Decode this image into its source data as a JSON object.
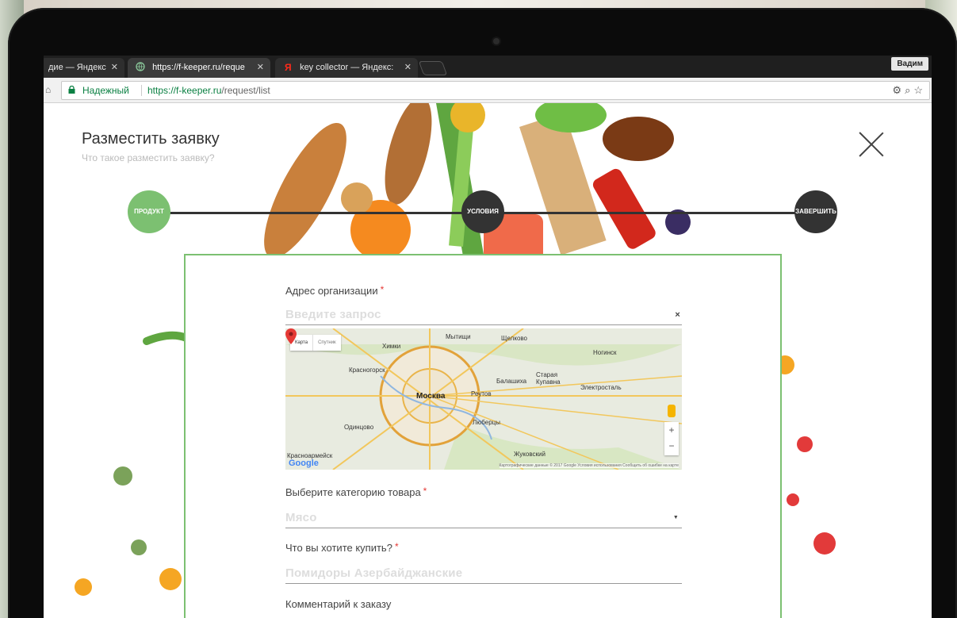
{
  "browser": {
    "tabs": [
      {
        "label": "дие — Яндекс",
        "close": "✕"
      },
      {
        "label": "https://f-keeper.ru/reque",
        "close": "✕"
      },
      {
        "label": "key collector — Яндекс:",
        "close": "✕"
      }
    ],
    "user": "Вадим",
    "secure_label": "Надежный",
    "url_host": "https://f-keeper.ru",
    "url_path": "/request/list"
  },
  "page": {
    "title": "Разместить заявку",
    "subtitle": "Что такое разместить заявку?",
    "steps": [
      "ПРОДУКТ",
      "УСЛОВИЯ",
      "ЗАВЕРШИТЬ"
    ]
  },
  "form": {
    "address": {
      "label": "Адрес организации",
      "placeholder": "Введите запрос",
      "clear": "×"
    },
    "map": {
      "types": [
        "Карта",
        "Спутник"
      ],
      "cities": [
        "Мытищи",
        "Щелково",
        "Химки",
        "Ногинск",
        "Электросталь",
        "Красногорск",
        "Москва",
        "Балашиха",
        "Старая Купавна",
        "Реутов",
        "Люберцы",
        "Одинцово",
        "Жуковский",
        "Красноармейск"
      ],
      "copyright": "Картографические данные © 2017 Google   Условия использования   Сообщить об ошибке на карте",
      "brand": "Google",
      "zoom_in": "+",
      "zoom_out": "−"
    },
    "category": {
      "label": "Выберите категорию товара",
      "value": "Мясо",
      "arrow": "▼"
    },
    "what": {
      "label": "Что вы хотите купить?",
      "placeholder": "Помидоры Азербайджанские"
    },
    "comment": {
      "label": "Комментарий к заказу"
    },
    "required_mark": "*"
  },
  "colors": {
    "accent": "#7cc071",
    "dark_step": "#333333",
    "secure": "#0b8043"
  }
}
